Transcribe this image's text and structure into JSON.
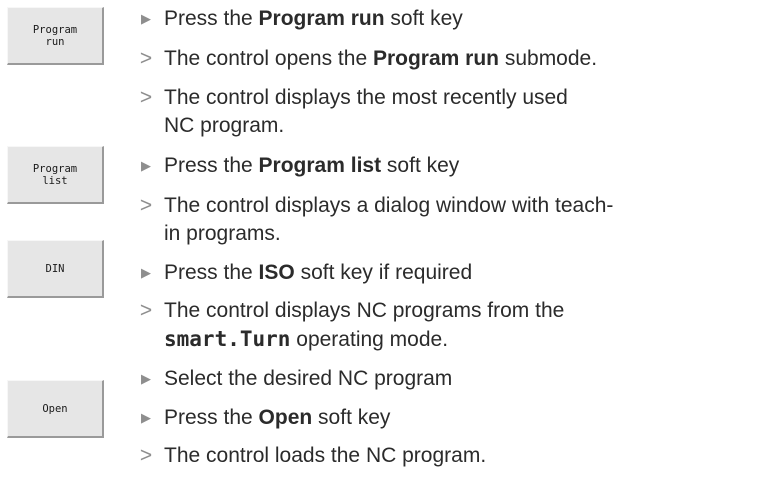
{
  "softkeys": [
    {
      "label": "Program\nrun"
    },
    {
      "label": "Program\nlist"
    },
    {
      "label": "DIN"
    },
    {
      "label": "Open"
    }
  ],
  "markers": {
    "action": "▶",
    "result": ">"
  },
  "steps": {
    "s1": {
      "pre": "Press the ",
      "bold": "Program run",
      "post": " soft key"
    },
    "s2": {
      "pre": "The control opens the ",
      "bold": "Program run",
      "post": " submode."
    },
    "s3": {
      "line1": "The control displays the most recently used",
      "line2": "NC program."
    },
    "s4": {
      "pre": "Press the ",
      "bold": "Program list",
      "post": " soft key"
    },
    "s5": {
      "line1": "The control displays a dialog window with teach-",
      "line2": "in programs."
    },
    "s6": {
      "pre": "Press the ",
      "bold": "ISO",
      "post": " soft key if required"
    },
    "s7": {
      "line1": "The control displays NC programs from the",
      "bold": "smart.Turn",
      "post": " operating mode."
    },
    "s8": {
      "text": "Select the desired NC program"
    },
    "s9": {
      "pre": "Press the ",
      "bold": "Open",
      "post": " soft key"
    },
    "s10": {
      "text": "The control loads the NC program."
    }
  }
}
